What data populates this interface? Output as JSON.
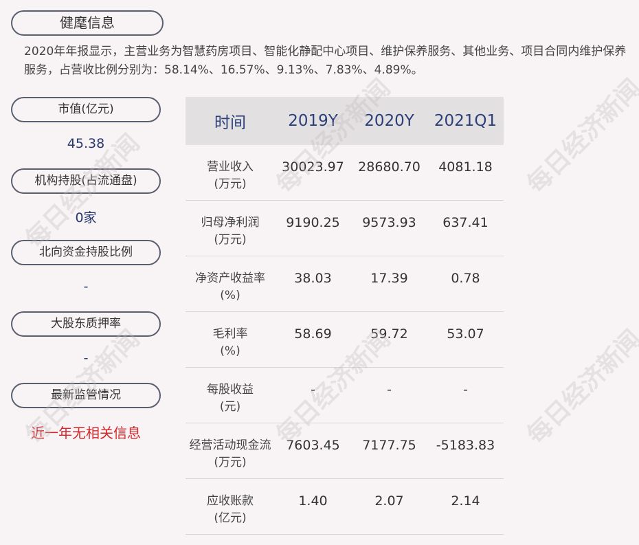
{
  "company": "健麾信息",
  "summary": "2020年年报显示，主营业务为智慧药房项目、智能化静配中心项目、维护保养服务、其他业务、项目合同内维护保养服务，占营收比例分别为：58.14%、16.57%、9.13%、7.83%、4.89%。",
  "side": {
    "market_cap_label": "市值(亿元)",
    "market_cap_value": "45.38",
    "institution_label": "机构持股(占流通盘)",
    "institution_value": "0家",
    "northbound_label": "北向资金持股比例",
    "northbound_value": "-",
    "pledge_label": "大股东质押率",
    "pledge_value": "-",
    "regulation_label": "最新监管情况",
    "regulation_value": "近一年无相关信息"
  },
  "table": {
    "headers": [
      "时间",
      "2019Y",
      "2020Y",
      "2021Q1"
    ],
    "rows": [
      {
        "label1": "营业收入",
        "label2": "(万元)",
        "values": [
          "30023.97",
          "28680.70",
          "4081.18"
        ]
      },
      {
        "label1": "归母净利润",
        "label2": "(万元)",
        "values": [
          "9190.25",
          "9573.93",
          "637.41"
        ]
      },
      {
        "label1": "净资产收益率",
        "label2": "(%)",
        "values": [
          "38.03",
          "17.39",
          "0.78"
        ]
      },
      {
        "label1": "毛利率",
        "label2": "(%)",
        "values": [
          "58.69",
          "59.72",
          "53.07"
        ]
      },
      {
        "label1": "每股收益",
        "label2": "(元)",
        "values": [
          "-",
          "-",
          "-"
        ]
      },
      {
        "label1": "经营活动现金流",
        "label2": "(万元)",
        "values": [
          "7603.45",
          "7177.75",
          "-5183.83"
        ]
      },
      {
        "label1": "应收账款",
        "label2": "(亿元)",
        "values": [
          "1.40",
          "2.07",
          "2.14"
        ]
      }
    ]
  },
  "watermark": "每日经济新闻"
}
